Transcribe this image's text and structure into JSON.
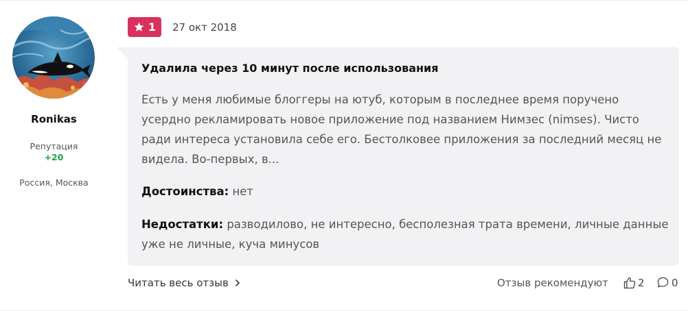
{
  "author": {
    "name": "Ronikas",
    "reputation_label": "Репутация",
    "reputation_value": "+20",
    "location": "Россия, Москва"
  },
  "review": {
    "rating": "1",
    "date": "27 окт 2018",
    "title": "Удалила через 10 минут после использования",
    "body": "Есть у меня любимые блоггеры на ютуб, которым в последнее время поручено усердно рекламировать новое приложение под названием Нимзес (nimses). Чисто ради интереса установила себе его. Бестолковее приложения за последний месяц не видела. Во-первых, в...",
    "pros_label": "Достоинства:",
    "pros_text": "нет",
    "cons_label": "Недостатки:",
    "cons_text": "разводилово, не интересно, бесполезная трата времени, личные данные уже не личные, куча минусов"
  },
  "footer": {
    "read_more": "Читать весь отзыв",
    "recommend_label": "Отзыв рекомендуют",
    "likes": "2",
    "comments": "0"
  },
  "colors": {
    "rating_badge": "#d8315e",
    "reputation_positive": "#1aa34a",
    "bubble_bg": "#f2f2f4"
  },
  "icons": {
    "rating": "star-icon",
    "read_more": "chevron-right-icon",
    "likes": "thumbs-up-icon",
    "comments": "comment-bubble-icon"
  }
}
